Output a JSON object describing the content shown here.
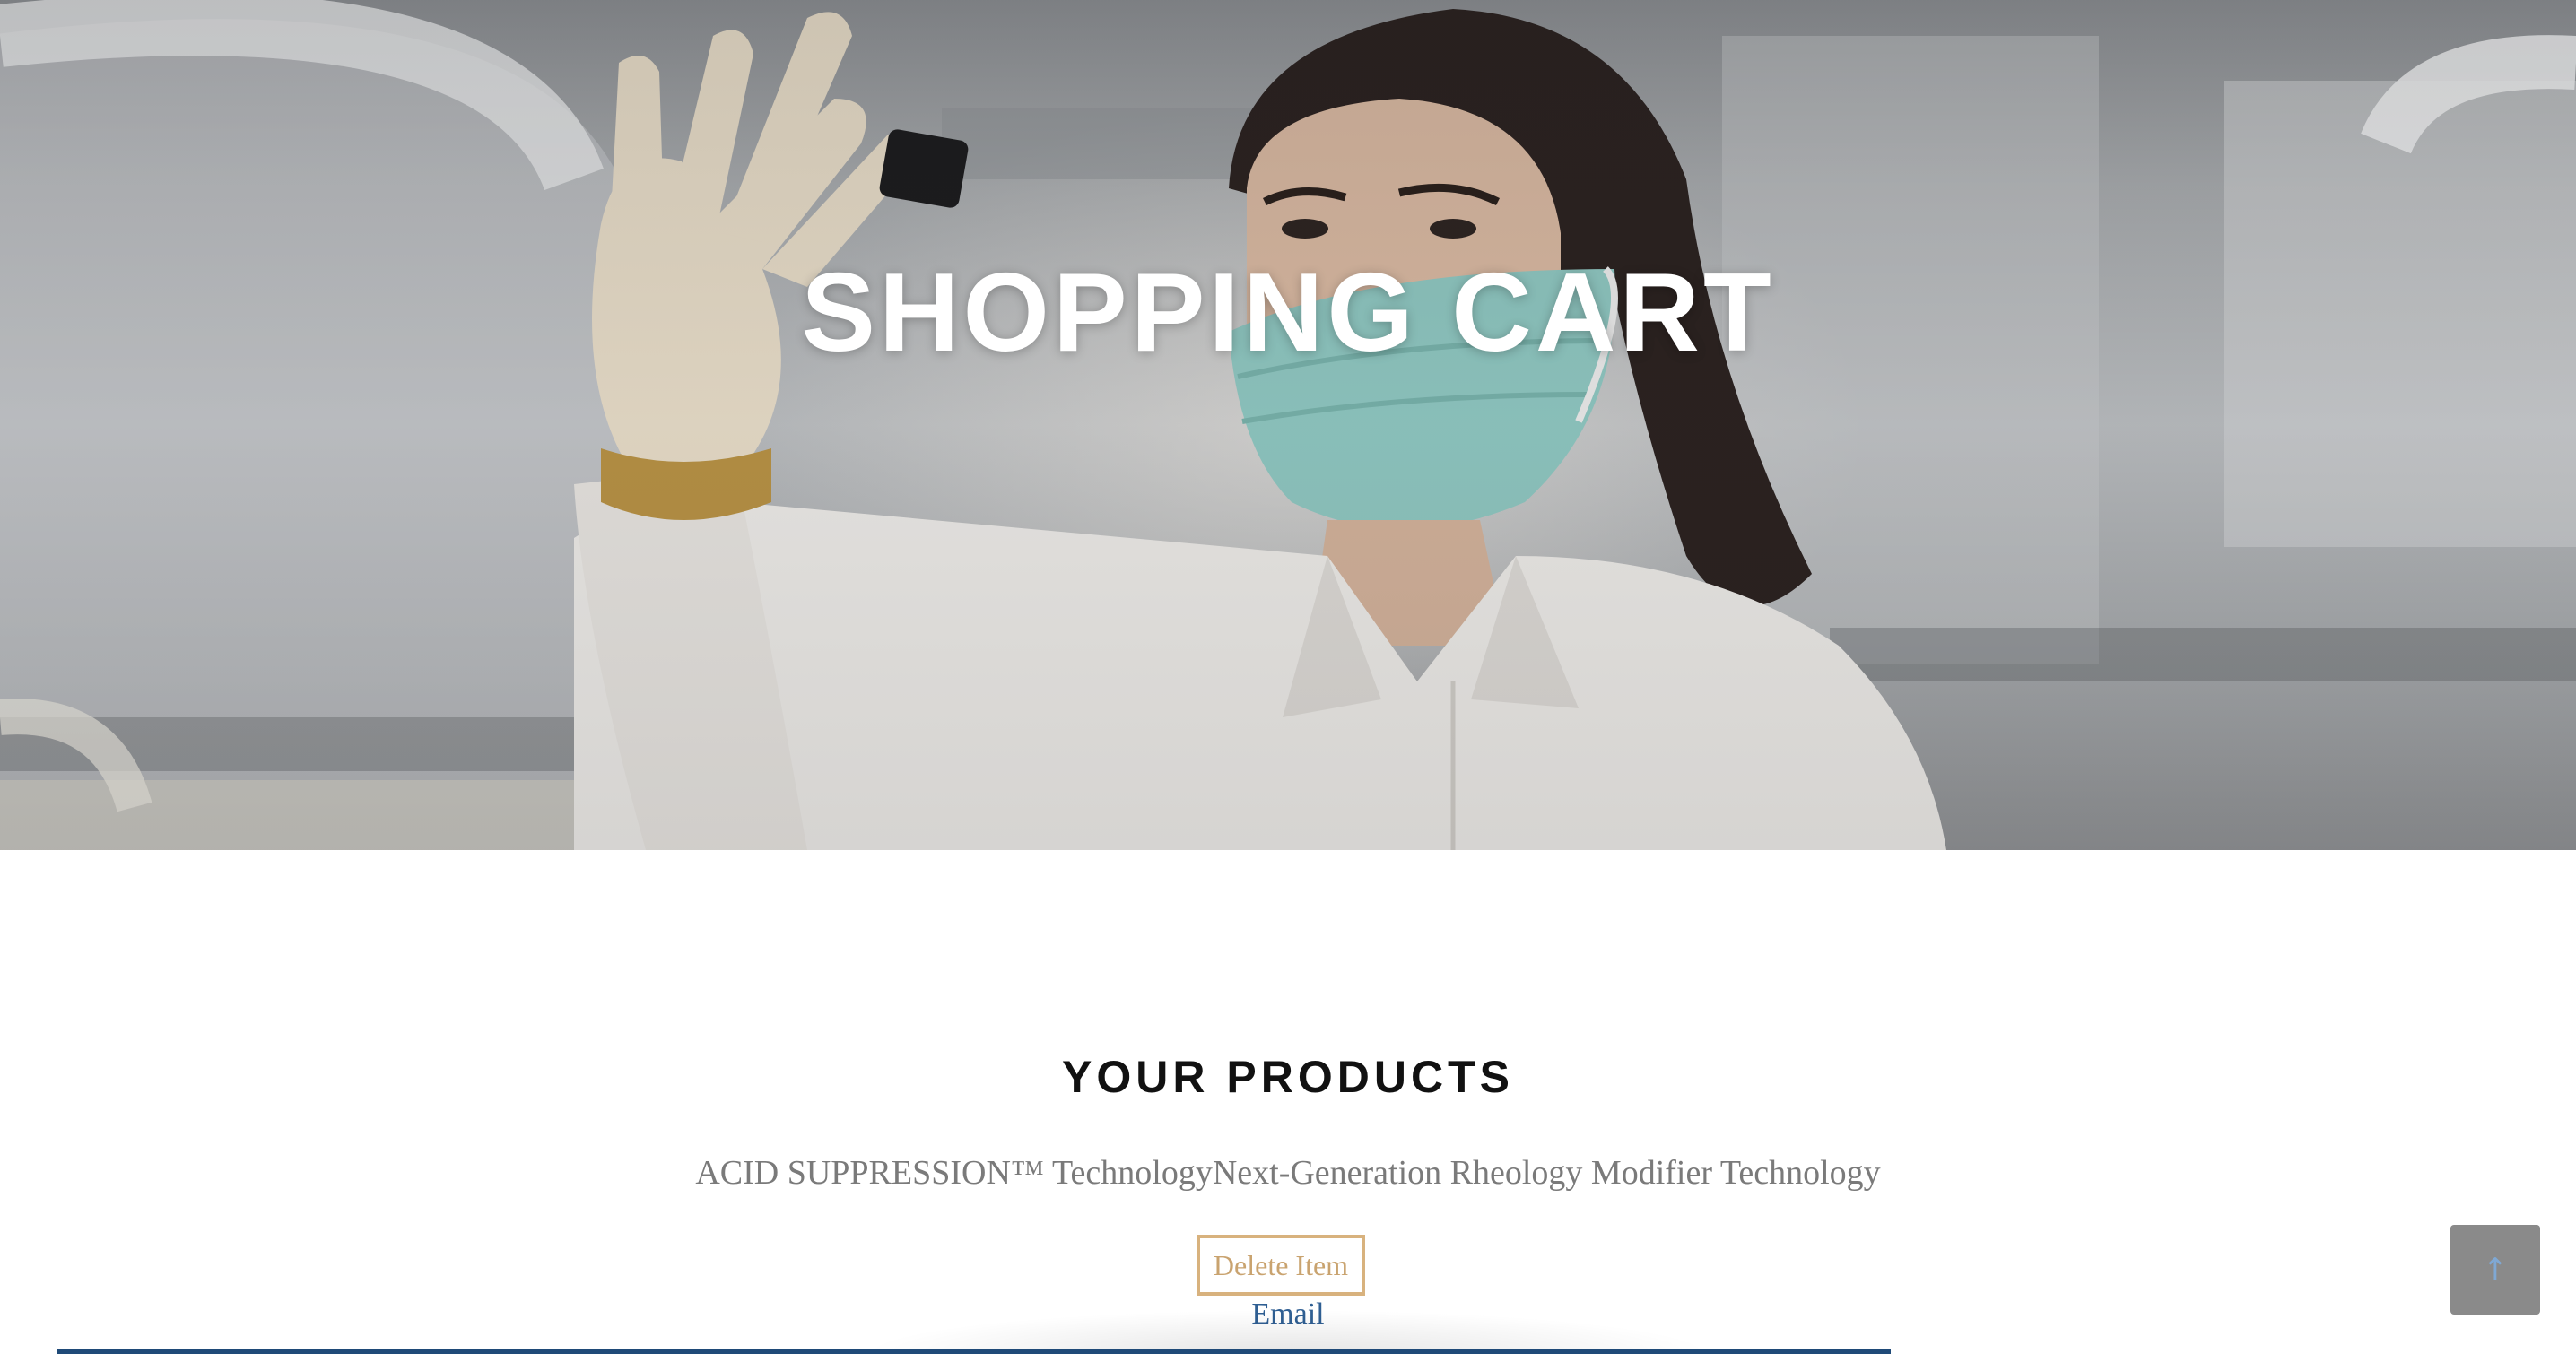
{
  "hero": {
    "title": "SHOPPING CART"
  },
  "products_section": {
    "heading": "YOUR PRODUCTS",
    "product_name": "ACID SUPPRESSION™  TechnologyNext-Generation Rheology Modifier Technology",
    "delete_label": "Delete Item",
    "email_label": "Email"
  },
  "back_to_top": {
    "icon": "arrow-up-icon",
    "glyph": "↑"
  },
  "colors": {
    "accent_gold": "#d8b27e",
    "link_blue": "#2f5f93",
    "bar_blue": "#1f4a78"
  }
}
